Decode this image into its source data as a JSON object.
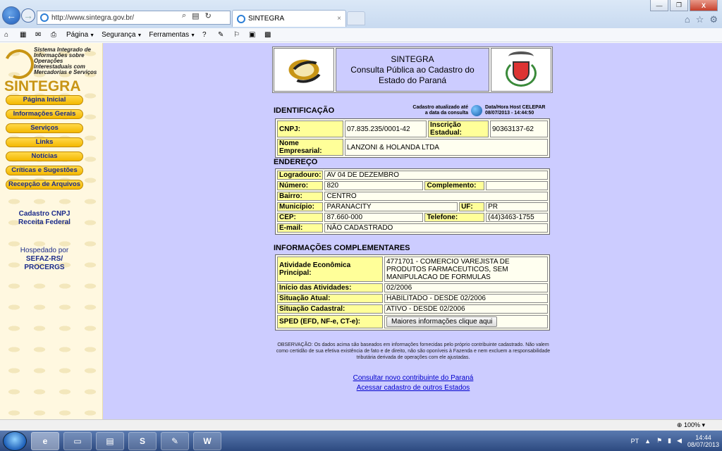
{
  "browser": {
    "url": "http://www.sintegra.gov.br/",
    "tab_title": "SINTEGRA",
    "close_tab": "×",
    "win_minimize": "—",
    "win_restore": "❐",
    "win_close": "X"
  },
  "commandbar": {
    "page": "Página",
    "security": "Segurança",
    "tools": "Ferramentas"
  },
  "sidebar": {
    "logo_desc": "Sistema Integrado de Informações sobre Operações Interestaduais com Mercadorias e Serviços",
    "logo_word": "SINTEGRA",
    "menu": [
      "Página Inicial",
      "Informações Gerais",
      "Serviços",
      "Links",
      "Notícias",
      "Críticas e Sugestões",
      "Recepção de Arquivos"
    ],
    "cnpj_line1": "Cadastro CNPJ",
    "cnpj_line2": "Receita Federal",
    "hosted_by": "Hospedado por",
    "hosted_line1": "SEFAZ-RS/",
    "hosted_line2": "PROCERGS"
  },
  "header": {
    "line1": "SINTEGRA",
    "line2": "Consulta Pública ao Cadastro do",
    "line3": "Estado do Paraná"
  },
  "identificacao": {
    "heading": "IDENTIFICAÇÃO",
    "updated_label_1": "Cadastro atualizado até",
    "updated_label_2": "a data da consulta",
    "host_label": "Data/Hora Host CELEPAR",
    "host_datetime": "08/07/2013 - 14:44:50",
    "cnpj_label": "CNPJ:",
    "cnpj": "07.835.235/0001-42",
    "ie_label": "Inscrição Estadual:",
    "ie": "90363137-62",
    "nome_label": "Nome Empresarial:",
    "nome": "LANZONI & HOLANDA LTDA"
  },
  "endereco": {
    "heading": "ENDEREÇO",
    "logradouro_label": "Logradouro:",
    "logradouro": "AV 04 DE DEZEMBRO",
    "numero_label": "Número:",
    "numero": "820",
    "complemento_label": "Complemento:",
    "complemento": "",
    "bairro_label": "Bairro:",
    "bairro": "CENTRO",
    "municipio_label": "Município:",
    "municipio": "PARANACITY",
    "uf_label": "UF:",
    "uf": "PR",
    "cep_label": "CEP:",
    "cep": "87.660-000",
    "telefone_label": "Telefone:",
    "telefone": "(44)3463-1755",
    "email_label": "E-mail:",
    "email": "NÃO CADASTRADO"
  },
  "complementares": {
    "heading": "INFORMAÇÕES COMPLEMENTARES",
    "atividade_label": "Atividade Econômica Principal:",
    "atividade": "4771701 - COMERCIO VAREJISTA DE PRODUTOS FARMACEUTICOS, SEM MANIPULACAO DE FORMULAS",
    "inicio_label": "Início das Atividades:",
    "inicio": "02/2006",
    "situacao_label": "Situação Atual:",
    "situacao": "HABILITADO - DESDE 02/2006",
    "cadastral_label": "Situação Cadastral:",
    "cadastral": "ATIVO - DESDE 02/2006",
    "sped_label": "SPED (EFD, NF-e, CT-e):",
    "sped_button": "Maiores informações clique aqui"
  },
  "observacao": "OBSERVAÇÃO: Os dados acima são baseados em informações fornecidas pelo próprio contribuinte cadastrado. Não valem como certidão de sua efetiva existência de fato e de direito, não são oponíveis à Fazenda e nem excluem a responsabilidade tributária derivada de operações com ele ajustadas.",
  "links": {
    "novo": "Consultar novo contribuinte do Paraná",
    "outros": "Acessar cadastro de outros Estados"
  },
  "statusbar": {
    "zoom": "100%"
  },
  "taskbar": {
    "lang": "PT",
    "time": "14:44",
    "date": "08/07/2013"
  }
}
